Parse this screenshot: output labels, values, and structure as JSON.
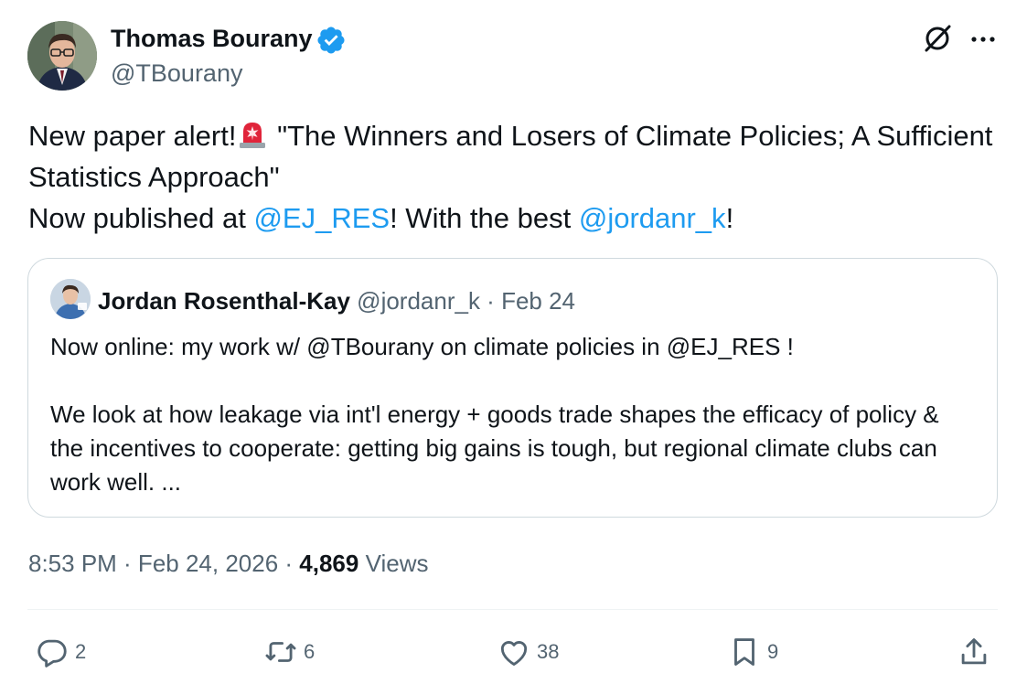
{
  "author": {
    "name": "Thomas Bourany",
    "handle": "@TBourany",
    "verified": true
  },
  "tweet": {
    "line1_text": "New paper alert!",
    "line1_emoji": "siren-emoji",
    "line1_rest": " \"The Winners and Losers of Climate Policies; A Sufficient Statistics Approach\"",
    "line2_pre": "Now published at ",
    "mention1": "@EJ_RES",
    "line2_mid": "! With the best ",
    "mention2": "@jordanr_k",
    "line2_end": "!"
  },
  "quote": {
    "name": "Jordan Rosenthal-Kay",
    "meta": " @jordanr_k · Feb 24",
    "body": "Now online: my work w/ @TBourany on climate policies in @EJ_RES !\n\nWe look at how leakage via int'l energy + goods trade shapes the efficacy of policy & the incentives to cooperate: getting big gains is tough, but regional climate clubs can work well. ..."
  },
  "meta": {
    "time_date": "8:53 PM · Feb 24, 2026 · ",
    "views_count": "4,869",
    "views_label": " Views"
  },
  "actions": {
    "replies": "2",
    "reposts": "6",
    "likes": "38",
    "bookmarks": "9"
  },
  "icons": {
    "verified": "verified-badge-icon",
    "grok": "grok-icon",
    "more": "more-options-icon",
    "reply": "reply-icon",
    "repost": "repost-icon",
    "like": "heart-icon",
    "bookmark": "bookmark-icon",
    "share": "share-icon"
  },
  "colors": {
    "link": "#1d9bf0",
    "secondary_text": "#536471",
    "primary_text": "#0f1419",
    "border": "#cfd9de"
  }
}
